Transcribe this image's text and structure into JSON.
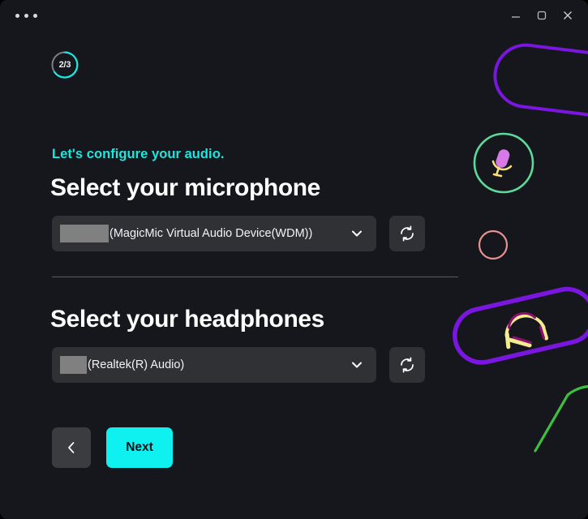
{
  "window": {
    "background_color": "#16171c",
    "accent_color": "#0ff0f0",
    "surface_color": "#2f3135"
  },
  "titlebar": {
    "menu_button_name": "more-options",
    "controls": [
      {
        "name": "minimize",
        "label": "Minimize"
      },
      {
        "name": "maximize",
        "label": "Maximize"
      },
      {
        "name": "close",
        "label": "Close"
      }
    ]
  },
  "progress": {
    "label": "2/3",
    "current_step": 2,
    "total_steps": 3,
    "arc_color": "#1ae8e0",
    "track_color": "#7e8088"
  },
  "main": {
    "subtitle": "Let's configure your audio.",
    "subtitle_color": "#1ae8e0",
    "microphone": {
      "heading": "Select your microphone",
      "selected_value": "(MagicMic Virtual Audio Device(WDM))",
      "has_redacted_prefix": true,
      "refresh_label": "Refresh microphone list"
    },
    "headphones": {
      "heading": "Select your headphones",
      "selected_value": "(Realtek(R) Audio)",
      "has_redacted_prefix": true,
      "refresh_label": "Refresh headphone list"
    }
  },
  "footer": {
    "back_label": "Back",
    "next_label": "Next"
  },
  "decorations": {
    "purple_pill_color": "#7a16e0",
    "green_circle_color": "#5dd99a",
    "pink_circle_color": "#e89293",
    "green_curve_color": "#3fbf3f",
    "mic_capsule_color": "#d77ae8",
    "mic_stand_color": "#f5e07a",
    "headphone_band_color": "#f5eb8f",
    "headphone_accent_color": "#8c1070"
  }
}
